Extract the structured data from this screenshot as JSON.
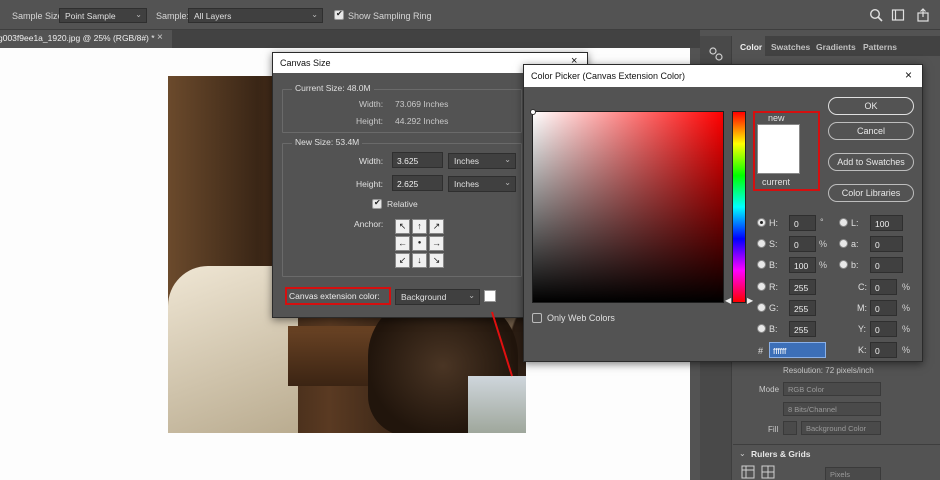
{
  "options_bar": {
    "sample_size_label": "Sample Size:",
    "sample_size_value": "Point Sample",
    "sample_label": "Sample:",
    "sample_value": "All Layers",
    "show_ring_label": "Show Sampling Ring",
    "show_ring_checked": true
  },
  "document_tab": {
    "title": "g003f9ee1a_1920.jpg @ 25% (RGB/8#) *",
    "close": "×"
  },
  "right_panel": {
    "tabs": [
      "Color",
      "Swatches",
      "Gradients",
      "Patterns"
    ],
    "active_tab": "Color",
    "resolution_text": "Resolution: 72 pixels/inch",
    "mode_label": "Mode",
    "mode_value": "RGB Color",
    "depth_value": "8 Bits/Channel",
    "fill_label": "Fill",
    "fill_value": "Background Color",
    "rulers_label": "Rulers & Grids",
    "rulers_unit": "Pixels"
  },
  "canvas_size": {
    "title": "Canvas Size",
    "close": "×",
    "current_size_label": "Current Size: 48.0M",
    "width_label": "Width:",
    "height_label": "Height:",
    "current_width": "73.069 Inches",
    "current_height": "44.292 Inches",
    "new_size_label": "New Size: 53.4M",
    "new_width": "3.625",
    "new_height": "2.625",
    "width_unit": "Inches",
    "height_unit": "Inches",
    "relative_label": "Relative",
    "relative_checked": true,
    "anchor_label": "Anchor:",
    "anchor_glyphs": [
      "↖",
      "↑",
      "↗",
      "←",
      "●",
      "→",
      "↙",
      "↓",
      "↘"
    ],
    "extension_label": "Canvas extension color:",
    "extension_value": "Background",
    "extension_swatch": "#ffffff"
  },
  "color_picker": {
    "title": "Color Picker (Canvas Extension Color)",
    "close": "×",
    "new_label": "new",
    "current_label": "current",
    "new_color": "#ffffff",
    "current_color": "#ffffff",
    "buttons": {
      "ok": "OK",
      "cancel": "Cancel",
      "add_to_swatches": "Add to Swatches",
      "color_libraries": "Color Libraries"
    },
    "only_web_colors": "Only Web Colors",
    "hsb": [
      {
        "label": "H:",
        "value": "0",
        "unit": "°",
        "selected": true
      },
      {
        "label": "S:",
        "value": "0",
        "unit": "%",
        "selected": false
      },
      {
        "label": "B:",
        "value": "100",
        "unit": "%",
        "selected": false
      }
    ],
    "rgb": [
      {
        "label": "R:",
        "value": "255"
      },
      {
        "label": "G:",
        "value": "255"
      },
      {
        "label": "B:",
        "value": "255"
      }
    ],
    "lab": [
      {
        "label": "L:",
        "value": "100"
      },
      {
        "label": "a:",
        "value": "0"
      },
      {
        "label": "b:",
        "value": "0"
      }
    ],
    "cmyk": [
      {
        "label": "C:",
        "value": "0",
        "unit": "%"
      },
      {
        "label": "M:",
        "value": "0",
        "unit": "%"
      },
      {
        "label": "Y:",
        "value": "0",
        "unit": "%"
      },
      {
        "label": "K:",
        "value": "0",
        "unit": "%"
      }
    ],
    "hex_label": "#",
    "hex_value": "ffffff"
  },
  "colors": {
    "highlight_red": "#d50f0f",
    "panel_bg": "#535353"
  }
}
